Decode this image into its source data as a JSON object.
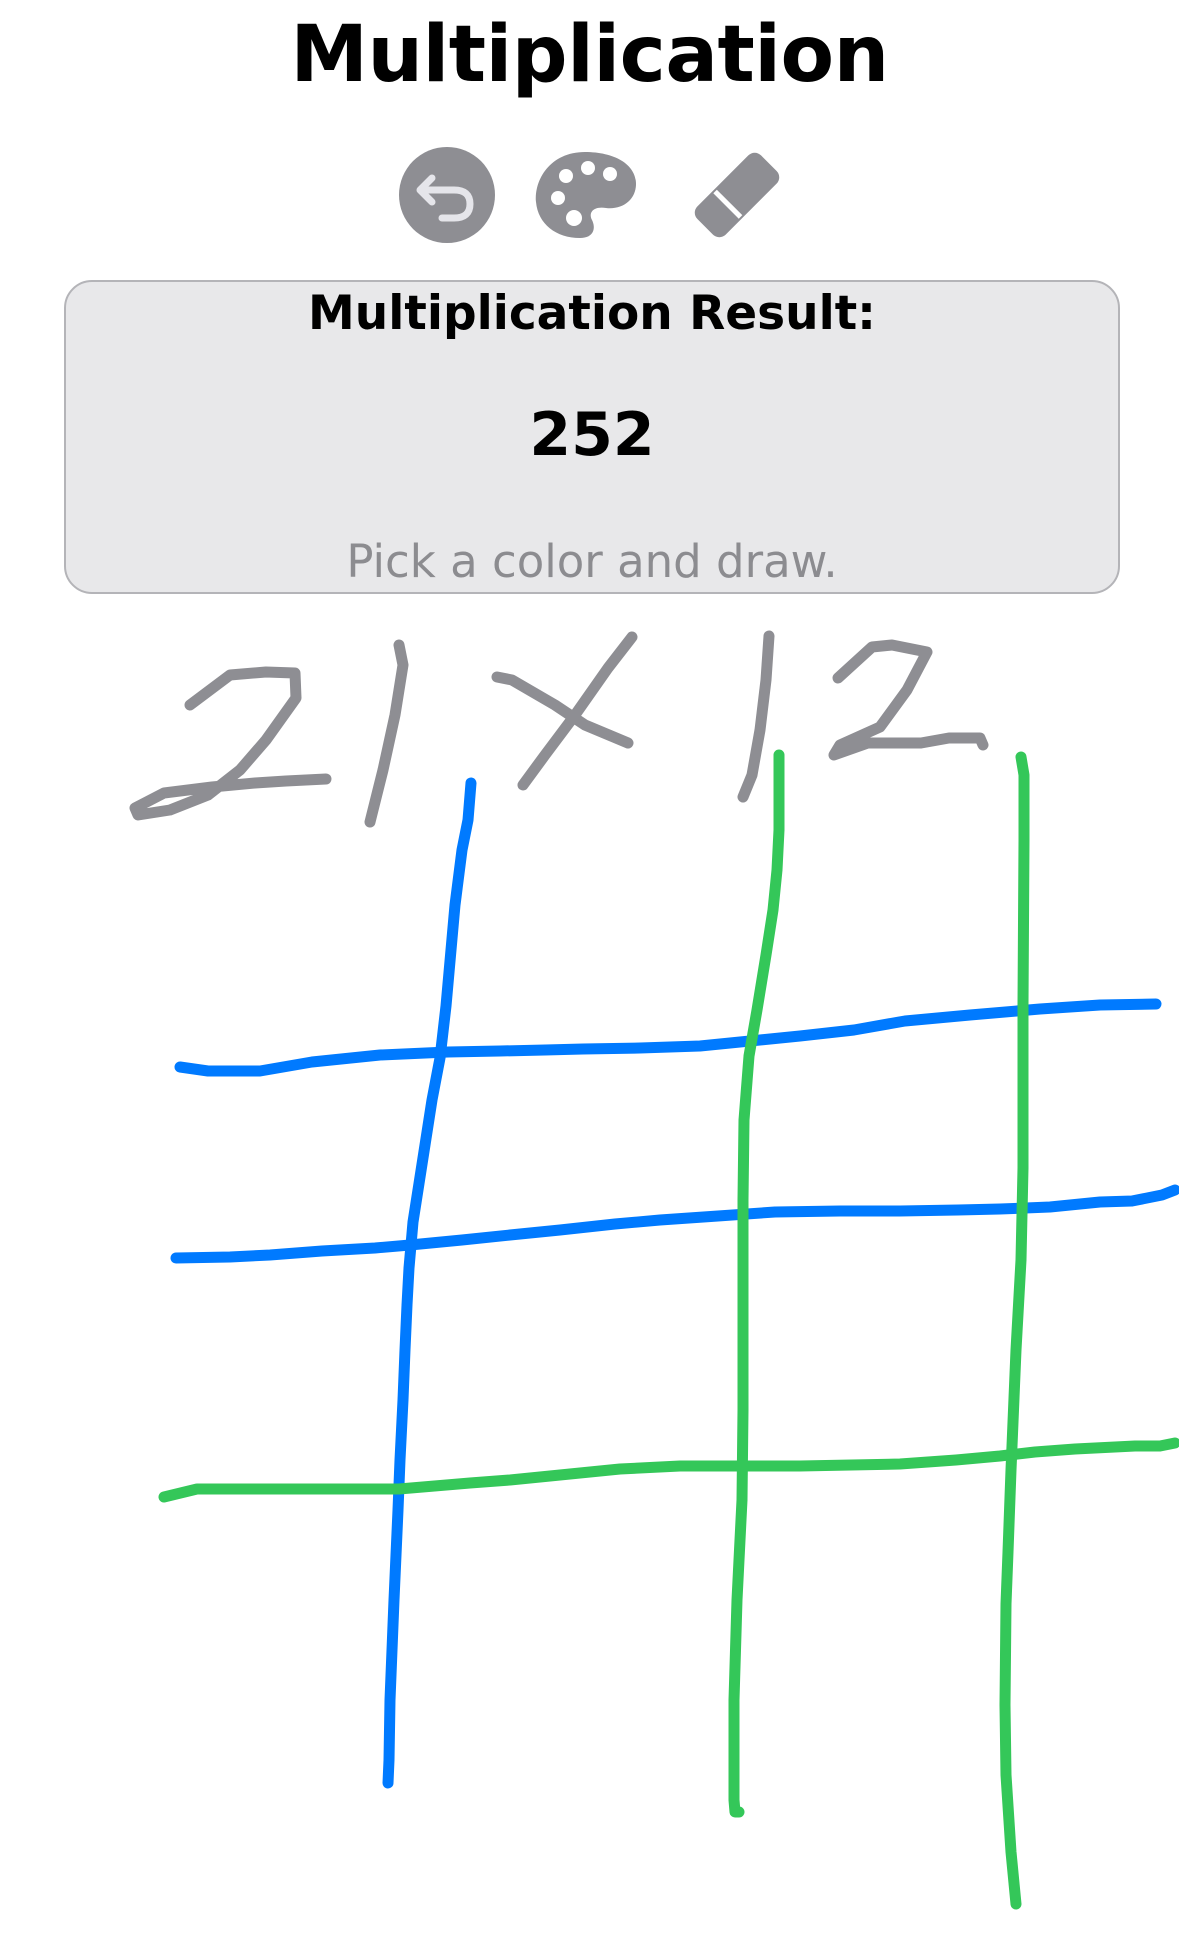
{
  "app": {
    "title": "Multiplication"
  },
  "toolbar": {
    "undo_icon": "undo-circle-icon",
    "palette_icon": "palette-icon",
    "eraser_icon": "eraser-icon",
    "icon_color": "#8e8e93"
  },
  "result_panel": {
    "heading": "Multiplication Result:",
    "value": "252",
    "hint": "Pick a color and draw."
  },
  "canvas": {
    "colors": {
      "gray": "#8e8e93",
      "blue": "#007aff",
      "green": "#34c759"
    }
  }
}
